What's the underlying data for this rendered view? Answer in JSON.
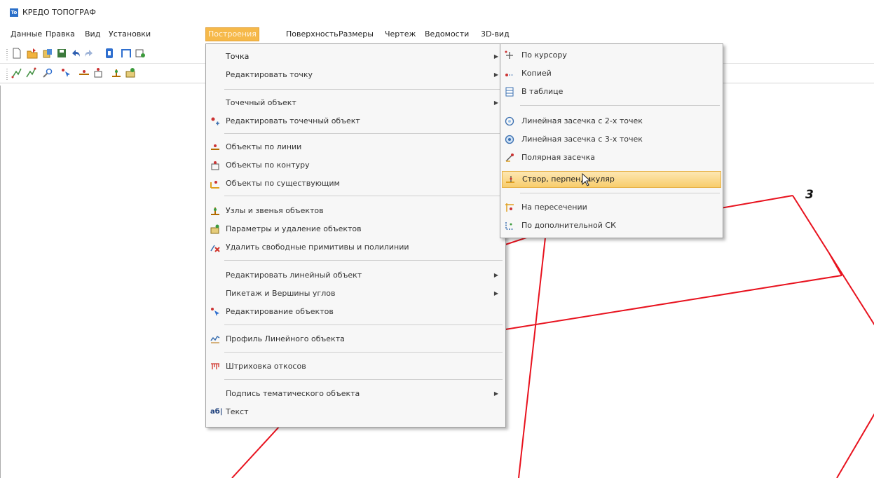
{
  "window": {
    "title": "КРЕДО ТОПОГРАФ",
    "icon": "app-logo-icon"
  },
  "menubar": {
    "items": [
      {
        "label": "Данные"
      },
      {
        "label": "Правка"
      },
      {
        "label": "Вид"
      },
      {
        "label": "Установки"
      },
      {
        "label": "Построения"
      },
      {
        "label": "Поверхность"
      },
      {
        "label": "Размеры"
      },
      {
        "label": "Чертеж"
      },
      {
        "label": "Ведомости"
      },
      {
        "label": "3D-вид"
      }
    ],
    "active": "Построения"
  },
  "dropdown": {
    "items": [
      {
        "label": "Точка"
      },
      {
        "label": "Редактировать точку"
      },
      {
        "label": "Точечный объект"
      },
      {
        "label": "Редактировать точечный объект"
      },
      {
        "label": "Объекты по линии"
      },
      {
        "label": "Объекты по контуру"
      },
      {
        "label": "Объекты по существующим"
      },
      {
        "label": "Узлы и звенья объектов"
      },
      {
        "label": "Параметры и удаление объектов"
      },
      {
        "label": "Удалить свободные примитивы и полилинии"
      },
      {
        "label": "Редактировать линейный объект"
      },
      {
        "label": "Пикетаж и Вершины углов"
      },
      {
        "label": "Редактирование объектов"
      },
      {
        "label": "Профиль Линейного объекта"
      },
      {
        "label": "Штриховка откосов"
      },
      {
        "label": "Подпись тематического объекта"
      },
      {
        "label": "Текст",
        "icon_text": "аб|"
      }
    ]
  },
  "submenu": {
    "items": [
      {
        "label": "По курсору"
      },
      {
        "label": "Копией"
      },
      {
        "label": "В таблице"
      },
      {
        "label": "Линейная засечка с 2-х точек"
      },
      {
        "label": "Линейная засечка с 3-х точек"
      },
      {
        "label": "Полярная засечка"
      },
      {
        "label": "Створ, перпендикуляр"
      },
      {
        "label": "На пересечении"
      },
      {
        "label": "По дополнительной СК"
      }
    ],
    "highlighted": "Створ, перпендикуляр"
  },
  "canvas": {
    "point_label": "3",
    "line_color": "#e8121e"
  },
  "colors": {
    "accent": "#f6b94a",
    "highlight": "#f8cd6c",
    "line": "#e8121e"
  }
}
